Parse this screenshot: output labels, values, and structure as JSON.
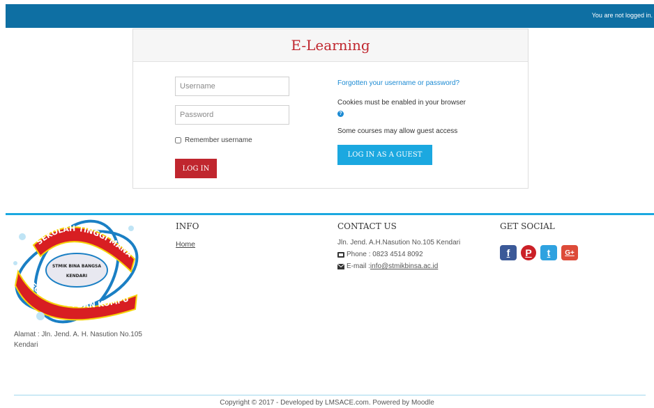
{
  "header": {
    "login_status": "You are not logged in."
  },
  "login": {
    "title": "E-Learning",
    "username_placeholder": "Username",
    "password_placeholder": "Password",
    "remember_label": "Remember username",
    "login_button": "LOG IN",
    "forgot_link": "Forgotten your username or password?",
    "cookies_text": "Cookies must be enabled in your browser",
    "help_icon": "question-circle-icon",
    "guest_text": "Some courses may allow guest access",
    "guest_button": "LOG IN AS A GUEST"
  },
  "footer": {
    "logo": {
      "name": "stmik-bina-bangsa-logo",
      "top_text": "SEKOLAH TINGGI MANAJEMEN",
      "bottom_text": "INFORMATIKA DAN KOMPUTER",
      "center_text": "STMIK BINA BANGSA",
      "city_text": "KENDARI"
    },
    "address": "Alamat : Jln. Jend. A. H. Nasution No.105 Kendari",
    "info": {
      "heading": "INFO",
      "links": [
        "Home"
      ]
    },
    "contact": {
      "heading": "CONTACT US",
      "address": "Jln. Jend. A.H.Nasution No.105 Kendari",
      "phone": "Phone : 0823 4514 8092",
      "email_label": "E-mail : ",
      "email": "info@stmikbinsa.ac.id"
    },
    "social": {
      "heading": "GET SOCIAL",
      "icons": [
        {
          "name": "facebook-icon",
          "glyph": "f",
          "color": "#3b5998"
        },
        {
          "name": "pinterest-icon",
          "glyph": "P",
          "color": "#cb2027"
        },
        {
          "name": "twitter-icon",
          "glyph": "t",
          "color": "#2fa2e0"
        },
        {
          "name": "google-plus-icon",
          "glyph": "G+",
          "color": "#dd4b39"
        }
      ]
    },
    "copyright": "Copyright © 2017 - Developed by LMSACE.com. Powered by Moodle"
  },
  "colors": {
    "topbar": "#0e6fa3",
    "brand_red": "#c0262e",
    "accent_blue": "#1ba8e0",
    "link_blue": "#1b8ad3"
  }
}
